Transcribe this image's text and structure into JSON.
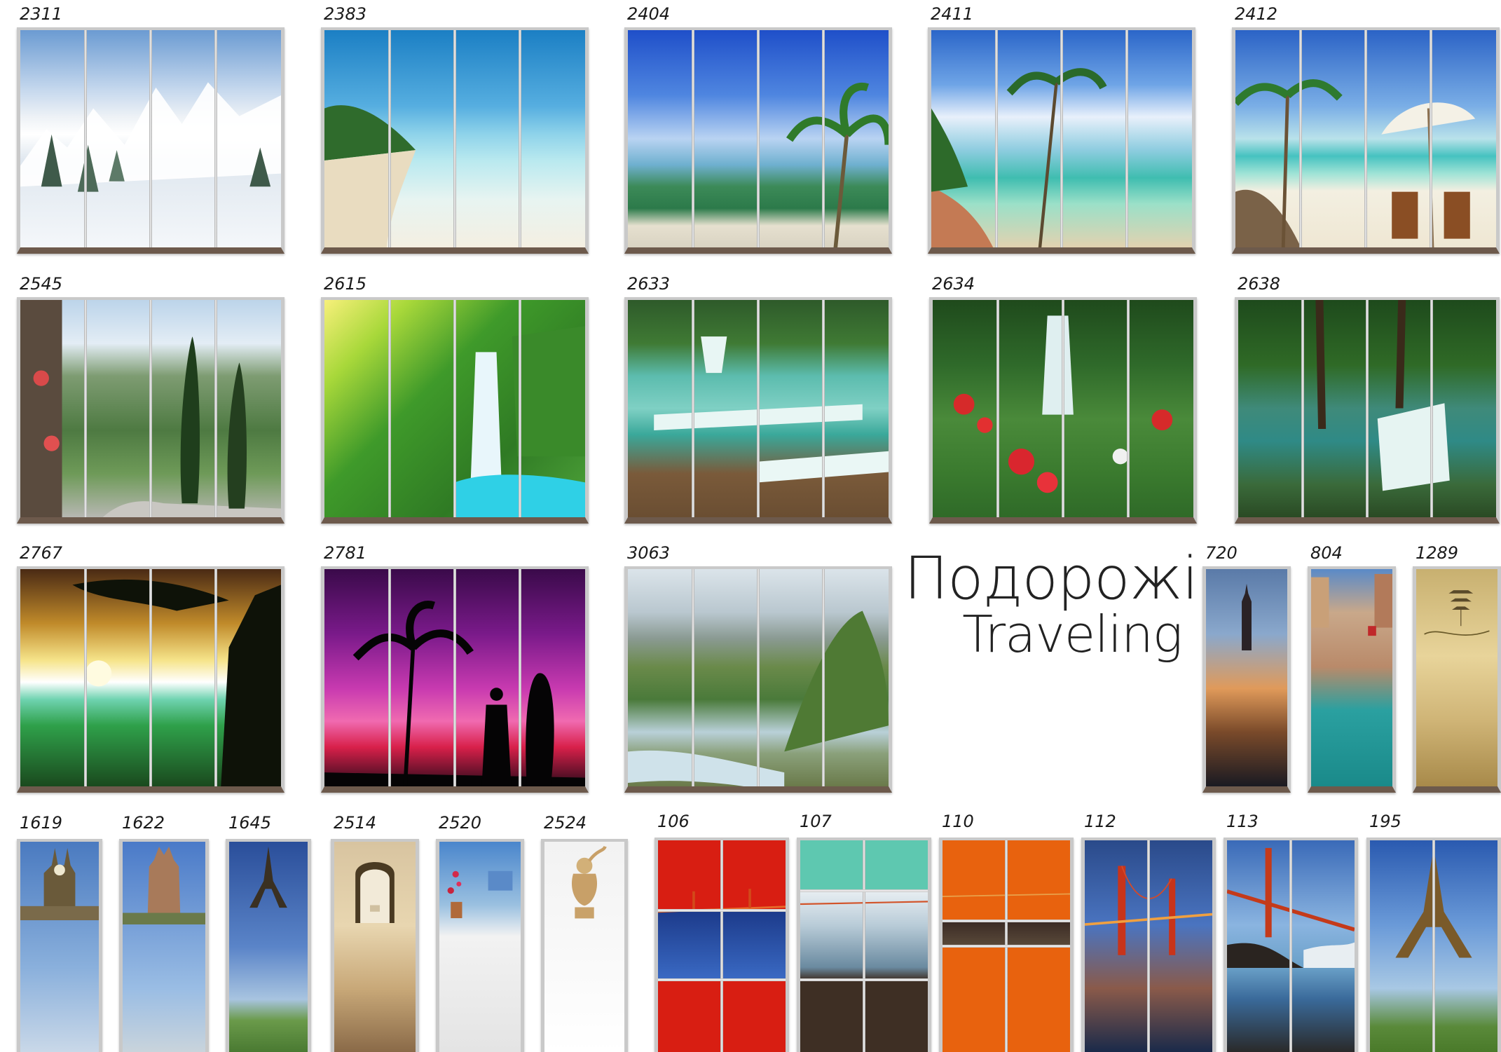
{
  "title": {
    "ua": "Подорожі",
    "en": "Traveling"
  },
  "items": [
    {
      "code": "2311",
      "scene": "snowy-mountains"
    },
    {
      "code": "2383",
      "scene": "tropical-beach"
    },
    {
      "code": "2404",
      "scene": "palm-lagoon"
    },
    {
      "code": "2411",
      "scene": "palm-rocks-sea"
    },
    {
      "code": "2412",
      "scene": "beach-chairs-umbrella"
    },
    {
      "code": "2545",
      "scene": "italian-road-cypress"
    },
    {
      "code": "2615",
      "scene": "jungle-waterfall"
    },
    {
      "code": "2633",
      "scene": "cascade-pools"
    },
    {
      "code": "2634",
      "scene": "flower-waterfall"
    },
    {
      "code": "2638",
      "scene": "forest-waterfall"
    },
    {
      "code": "2767",
      "scene": "sunset-tree"
    },
    {
      "code": "2781",
      "scene": "purple-palm-surfer"
    },
    {
      "code": "3063",
      "scene": "river-painting"
    },
    {
      "code": "720",
      "scene": "city-skyscraper"
    },
    {
      "code": "804",
      "scene": "venice-canal"
    },
    {
      "code": "1289",
      "scene": "pagoda-sketch"
    },
    {
      "code": "1619",
      "scene": "big-ben"
    },
    {
      "code": "1622",
      "scene": "old-tower"
    },
    {
      "code": "1645",
      "scene": "eiffel-tower"
    },
    {
      "code": "2514",
      "scene": "arabic-arches"
    },
    {
      "code": "2520",
      "scene": "white-stairs-flowers"
    },
    {
      "code": "2524",
      "scene": "cherub-statue"
    },
    {
      "code": "106",
      "scene": "red-bridge-panels"
    },
    {
      "code": "107",
      "scene": "teal-bridge-panels"
    },
    {
      "code": "110",
      "scene": "orange-bridge-panels"
    },
    {
      "code": "112",
      "scene": "golden-gate-night"
    },
    {
      "code": "113",
      "scene": "golden-gate-day"
    },
    {
      "code": "195",
      "scene": "eiffel-tower-wide"
    }
  ]
}
